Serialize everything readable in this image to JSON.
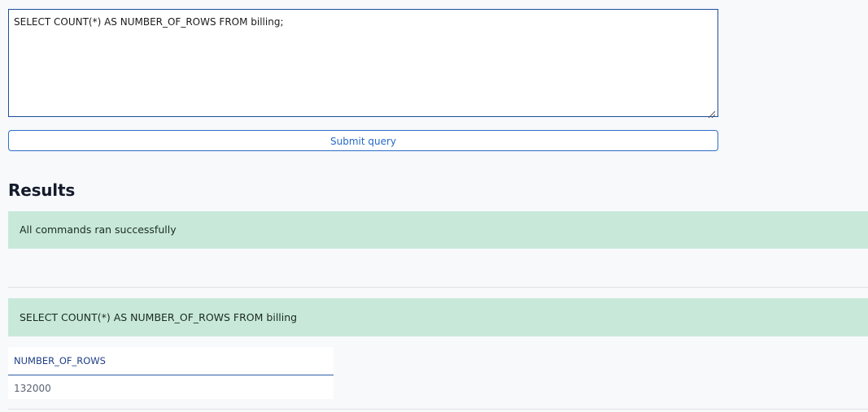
{
  "query_editor": {
    "value": "SELECT COUNT(*) AS NUMBER_OF_ROWS FROM billing;"
  },
  "submit_button": {
    "label": "Submit query"
  },
  "results": {
    "heading": "Results",
    "status_message": "All commands ran successfully",
    "statements": [
      {
        "query": "SELECT COUNT(*) AS NUMBER_OF_ROWS FROM billing",
        "table": {
          "columns": [
            "NUMBER_OF_ROWS"
          ],
          "rows": [
            [
              "132000"
            ]
          ]
        }
      }
    ]
  },
  "colors": {
    "page_background": "#f8f9fb",
    "accent_blue": "#2769c9",
    "success_background": "#c8e9d9",
    "heading_text": "#141c2b"
  },
  "icons": {
    "resize_grip": "resize-handle-icon"
  }
}
